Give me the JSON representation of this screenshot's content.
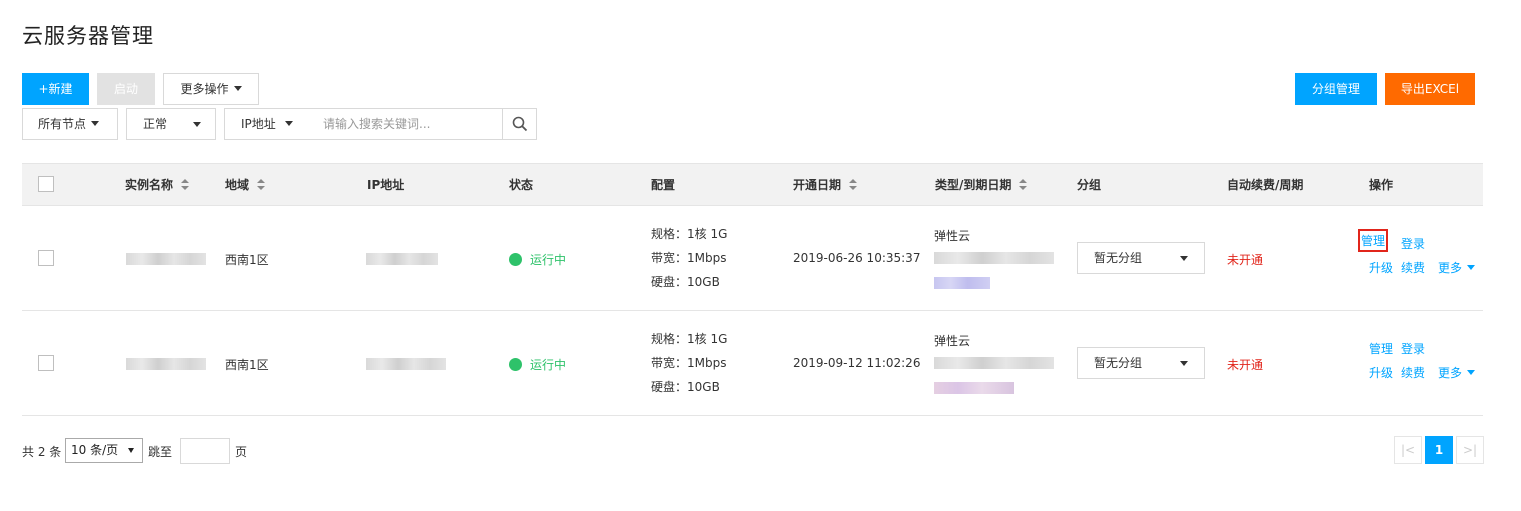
{
  "page_title": "云服务器管理",
  "toolbar": {
    "new_label": "+新建",
    "start_label": "启动",
    "more_ops_label": "更多操作",
    "group_manage_label": "分组管理",
    "export_label": "导出EXCEl"
  },
  "filters": {
    "node_label": "所有节点",
    "status_label": "正常",
    "field_label": "IP地址",
    "search_placeholder": "请输入搜索关键词..."
  },
  "table": {
    "headers": {
      "name": "实例名称",
      "region": "地域",
      "ip": "IP地址",
      "status": "状态",
      "config": "配置",
      "open_date": "开通日期",
      "type_expire": "类型/到期日期",
      "group": "分组",
      "auto_renew": "自动续费/周期",
      "actions": "操作"
    },
    "rows": [
      {
        "region": "西南1区",
        "status": "运行中",
        "spec": "规格：1核 1G",
        "bandwidth": "带宽：1Mbps",
        "disk": "硬盘：10GB",
        "open_date": "2019-06-26 10:35:37",
        "type": "弹性云",
        "group": "暂无分组",
        "auto_renew": "未开通",
        "action_manage": "管理",
        "action_login": "登录",
        "action_upgrade": "升级",
        "action_renew": "续费",
        "action_more": "更多"
      },
      {
        "region": "西南1区",
        "status": "运行中",
        "spec": "规格：1核 1G",
        "bandwidth": "带宽：1Mbps",
        "disk": "硬盘：10GB",
        "open_date": "2019-09-12 11:02:26",
        "type": "弹性云",
        "group": "暂无分组",
        "auto_renew": "未开通",
        "action_manage": "管理",
        "action_login": "登录",
        "action_upgrade": "升级",
        "action_renew": "续费",
        "action_more": "更多"
      }
    ]
  },
  "pagination": {
    "total_label": "共 2 条",
    "page_size": "10 条/页",
    "jump_label": "跳至",
    "page_unit": "页",
    "prev": "|<",
    "current_page": "1",
    "next": ">|"
  },
  "colors": {
    "primary": "#00a4ff",
    "export": "#ff6a00",
    "running": "#2ec26a",
    "disabled": "#e1251b"
  }
}
